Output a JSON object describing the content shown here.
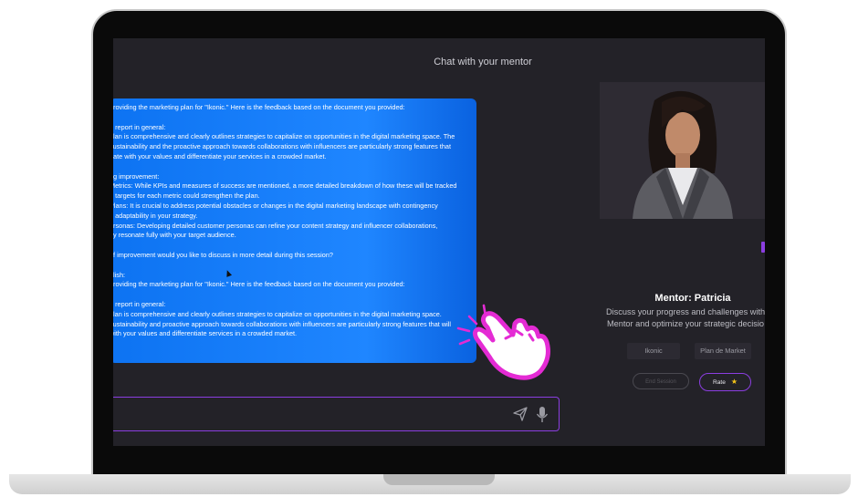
{
  "chat": {
    "title": "Chat with your mentor",
    "message_lines": [
      "providing the marketing plan for \"Ikonic.\" Here is the feedback based on the document you provided:",
      "",
      "e report in general:",
      "plan is comprehensive and clearly outlines strategies to capitalize on opportunities in the digital marketing space. The",
      "sustainability and the proactive approach towards collaborations with influencers are particularly strong features that",
      "nate with your values and differentiate your services in a crowded market.",
      "",
      "ng improvement:",
      "Metrics: While KPIs and measures of success are mentioned, a more detailed breakdown of how these will be tracked",
      "e targets for each metric could strengthen the plan.",
      "Plans: It is crucial to address potential obstacles or changes in the digital marketing landscape with contingency",
      "g adaptability in your strategy.",
      "ersonas: Developing detailed customer personas can refine your content strategy and influencer collaborations,",
      "ey resonate fully with your target audience.",
      "",
      "of improvement would you like to discuss in more detail during this session?",
      "",
      "glish:",
      "providing the marketing plan for \"Ikonic.\" Here is the feedback based on the document you provided:",
      "",
      "e report in general:",
      "plan is comprehensive and clearly outlines strategies to capitalize on opportunities in the digital marketing space.",
      "sustainability and proactive approach towards collaborations with influencers are particularly strong features that will",
      "with your values and differentiate services in a crowded market."
    ],
    "input": {
      "value": "",
      "placeholder": ""
    },
    "send_icon": "send-icon",
    "mic_icon": "microphone-icon"
  },
  "mentor": {
    "name": "Mentor: Patricia",
    "description_lines": [
      "Discuss your progress and challenges with",
      "Mentor and optimize your strategic decisio"
    ],
    "tags": [
      "Ikonic",
      "Plan de Market"
    ],
    "end_session_label": "End Session",
    "rate_label": "Rate",
    "rate_icon": "star-icon"
  },
  "colors": {
    "accent": "#8b3ee0",
    "bubble": "#1a80ff",
    "background": "#232228",
    "hand": "#e42bd4",
    "star": "#f5c518"
  }
}
